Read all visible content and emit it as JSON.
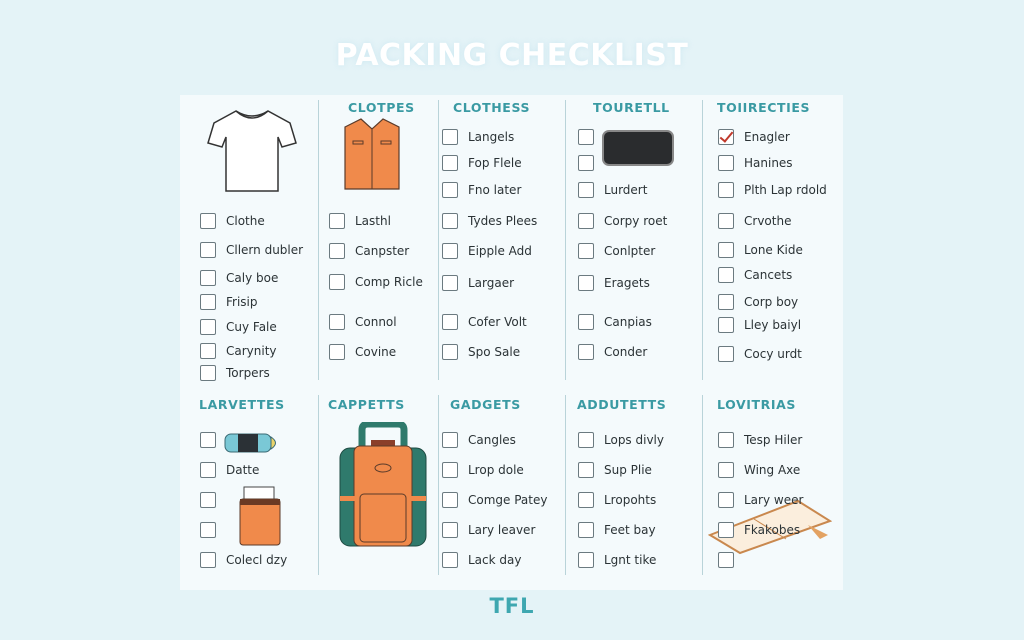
{
  "title": "PACKING CHECKLIST",
  "footer_logo": "TFL",
  "colors": {
    "accent": "#3a9aa3",
    "background": "#e4f3f7",
    "panel": "#f4fafc",
    "check": "#c0392b",
    "orange": "#f08a4b",
    "green": "#2f7a6c"
  },
  "sections": [
    {
      "header": "",
      "items": [
        {
          "label": "Clothe"
        },
        {
          "label": "Cllern dubler"
        },
        {
          "label": "Caly boe"
        },
        {
          "label": "Frisip"
        },
        {
          "label": "Cuy Fale"
        },
        {
          "label": "Carynity"
        },
        {
          "label": "Torpers"
        }
      ]
    },
    {
      "header": "CLOTPES",
      "items": [
        {
          "label": "Lasthl"
        },
        {
          "label": "Canpster"
        },
        {
          "label": "Comp Ricle"
        },
        {
          "label": "Connol"
        },
        {
          "label": "Covine"
        }
      ]
    },
    {
      "header": "CLOTHESS",
      "items": [
        {
          "label": "Langels"
        },
        {
          "label": "Fop Flele"
        },
        {
          "label": "Fno later"
        },
        {
          "label": "Tydes Plees"
        },
        {
          "label": "Eipple Add"
        },
        {
          "label": "Largaer"
        },
        {
          "label": "Cofer Volt"
        },
        {
          "label": "Spo Sale"
        }
      ]
    },
    {
      "header": "TOURETLL",
      "items": [
        {
          "label": ""
        },
        {
          "label": ""
        },
        {
          "label": "Lurdert"
        },
        {
          "label": "Corpy roet"
        },
        {
          "label": "Conlpter"
        },
        {
          "label": "Eragets"
        },
        {
          "label": "Canpias"
        },
        {
          "label": "Conder"
        }
      ]
    },
    {
      "header": "TOIIRECTIES",
      "items": [
        {
          "label": "Enagler",
          "checked": true
        },
        {
          "label": "Hanines"
        },
        {
          "label": "Plth Lap rdold"
        },
        {
          "label": "Crvothe"
        },
        {
          "label": "Lone Kide"
        },
        {
          "label": "Cancets"
        },
        {
          "label": "Corp boy"
        },
        {
          "label": "Lley baiyl"
        },
        {
          "label": "Cocy urdt"
        }
      ]
    },
    {
      "header": "LARVETTES",
      "items": [
        {
          "label": ""
        },
        {
          "label": "Datte"
        },
        {
          "label": ""
        },
        {
          "label": ""
        },
        {
          "label": "Colecl dzy"
        }
      ]
    },
    {
      "header": "CAPPETTS",
      "items": []
    },
    {
      "header": "GADGETS",
      "items": [
        {
          "label": "Cangles"
        },
        {
          "label": "Lrop dole"
        },
        {
          "label": "Comge Patey"
        },
        {
          "label": "Lary leaver"
        },
        {
          "label": "Lack day"
        }
      ]
    },
    {
      "header": "ADDUTETTS",
      "items": [
        {
          "label": "Lops divly"
        },
        {
          "label": "Sup Plie"
        },
        {
          "label": "Lropohts"
        },
        {
          "label": "Feet bay"
        },
        {
          "label": "Lgnt tike"
        }
      ]
    },
    {
      "header": "LOVITRIAS",
      "items": [
        {
          "label": "Tesp Hiler"
        },
        {
          "label": "Wing Axe"
        },
        {
          "label": "Lary weer"
        },
        {
          "label": "Fkakobes"
        },
        {
          "label": ""
        }
      ]
    }
  ],
  "icons": [
    "t-shirt-icon",
    "shirt-icon",
    "phone-icon",
    "sunglasses-case-icon",
    "pouch-icon",
    "backpack-icon",
    "notebook-pencil-icon"
  ]
}
